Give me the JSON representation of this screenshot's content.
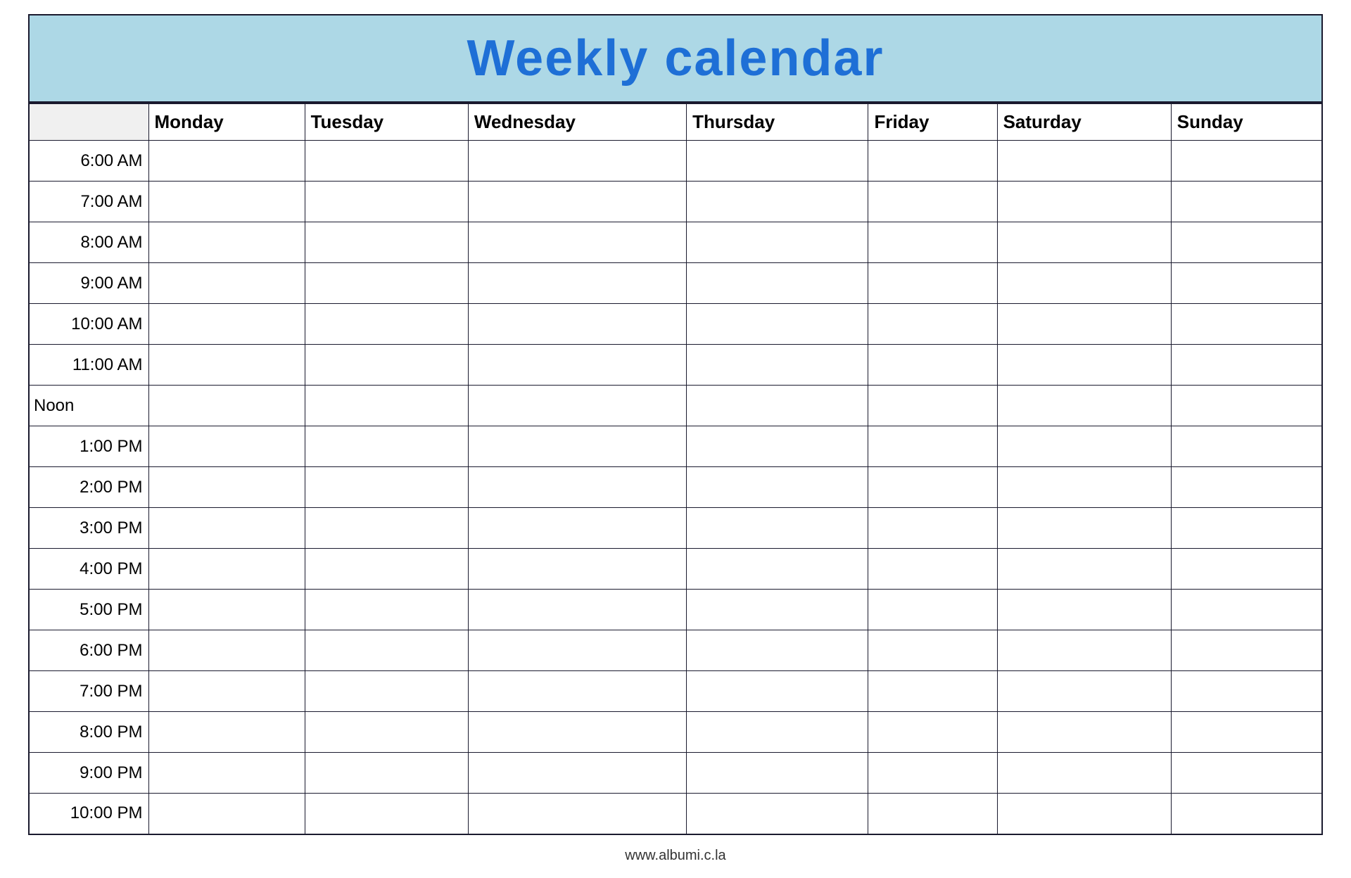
{
  "header": {
    "title": "Weekly calendar",
    "background_color": "#add8e6",
    "title_color": "#1e6fd6"
  },
  "columns": {
    "time_header": "",
    "days": [
      "Monday",
      "Tuesday",
      "Wednesday",
      "Thursday",
      "Friday",
      "Saturday",
      "Sunday"
    ]
  },
  "time_slots": [
    "6:00 AM",
    "7:00 AM",
    "8:00 AM",
    "9:00 AM",
    "10:00 AM",
    "11:00 AM",
    "Noon",
    "1:00 PM",
    "2:00 PM",
    "3:00 PM",
    "4:00 PM",
    "5:00 PM",
    "6:00 PM",
    "7:00 PM",
    "8:00 PM",
    "9:00 PM",
    "10:00 PM"
  ],
  "footer": {
    "text": "www.albumi.c.la"
  }
}
